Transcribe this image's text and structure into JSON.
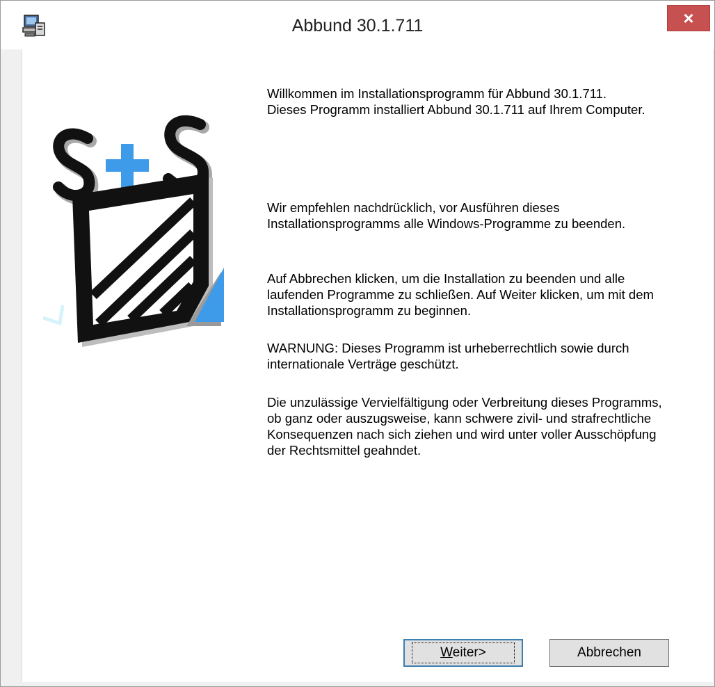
{
  "window": {
    "title": "Abbund 30.1.711",
    "close_label": "×",
    "app_icon": "setup-computer-icon"
  },
  "logo": {
    "text": "S+S",
    "accent_color": "#3d9be9"
  },
  "content": {
    "welcome_line1": "Willkommen im Installationsprogramm für Abbund 30.1.711.",
    "welcome_line2": "Dieses Programm installiert  Abbund 30.1.711 auf Ihrem Computer.",
    "recommend": "Wir empfehlen nachdrücklich, vor Ausführen dieses Installationsprogramms alle Windows-Programme zu beenden.",
    "cancel_info": "Auf Abbrechen klicken, um die Installation zu beenden und alle laufenden Programme zu schließen. Auf Weiter klicken, um mit dem Installationsprogramm zu beginnen.",
    "warning": "WARNUNG: Dieses Programm ist urheberrechtlich sowie durch internationale Verträge geschützt.",
    "legal": "Die unzulässige Vervielfältigung oder Verbreitung dieses Programms, ob ganz oder auszugsweise, kann schwere zivil- und strafrechtliche Konsequenzen nach sich ziehen und wird unter voller Ausschöpfung der Rechtsmittel geahndet."
  },
  "buttons": {
    "next_accel": "W",
    "next_rest": "eiter>",
    "cancel": "Abbrechen"
  }
}
